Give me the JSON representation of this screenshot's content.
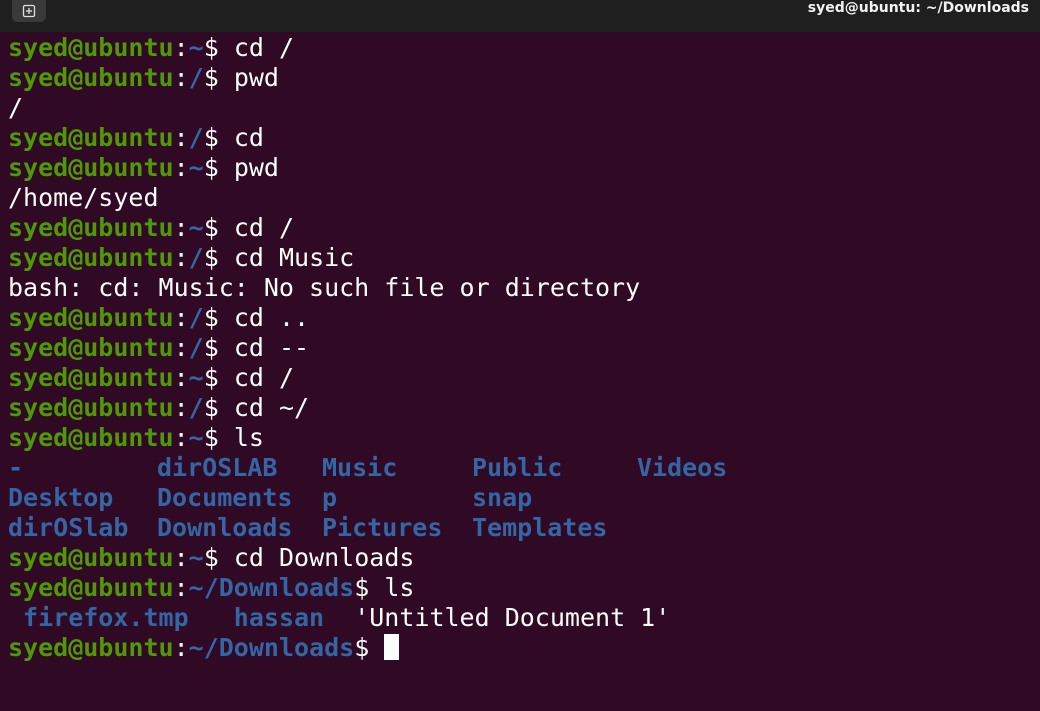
{
  "window": {
    "title": "syed@ubuntu: ~/Downloads"
  },
  "colors": {
    "background": "#300a24",
    "titlebar": "#1f1f1f",
    "user_host": "#4e9a06",
    "path": "#3465a4",
    "text": "#ffffff"
  },
  "icons": {
    "new_tab": "new-tab-icon"
  },
  "terminal": {
    "prompt_user": "syed@ubuntu",
    "lines": [
      {
        "type": "prompt",
        "path": "~",
        "cmd": "cd /"
      },
      {
        "type": "prompt",
        "path": "/",
        "cmd": "pwd"
      },
      {
        "type": "output",
        "text": "/"
      },
      {
        "type": "prompt",
        "path": "/",
        "cmd": "cd"
      },
      {
        "type": "prompt",
        "path": "~",
        "cmd": "pwd"
      },
      {
        "type": "output",
        "text": "/home/syed"
      },
      {
        "type": "prompt",
        "path": "~",
        "cmd": "cd /"
      },
      {
        "type": "prompt",
        "path": "/",
        "cmd": "cd Music"
      },
      {
        "type": "output",
        "text": "bash: cd: Music: No such file or directory"
      },
      {
        "type": "prompt",
        "path": "/",
        "cmd": "cd .."
      },
      {
        "type": "prompt",
        "path": "/",
        "cmd": "cd --"
      },
      {
        "type": "prompt",
        "path": "~",
        "cmd": "cd /"
      },
      {
        "type": "prompt",
        "path": "/",
        "cmd": "cd ~/"
      },
      {
        "type": "prompt",
        "path": "~",
        "cmd": "ls"
      },
      {
        "type": "ls",
        "cols": [
          "-",
          "dirOSLAB",
          "Music",
          "Public",
          "Videos"
        ]
      },
      {
        "type": "ls",
        "cols": [
          "Desktop",
          "Documents",
          "p",
          "snap",
          ""
        ]
      },
      {
        "type": "ls",
        "cols": [
          "dirOSlab",
          "Downloads",
          "Pictures",
          "Templates",
          ""
        ]
      },
      {
        "type": "prompt",
        "path": "~",
        "cmd": "cd Downloads"
      },
      {
        "type": "prompt",
        "path": "~/Downloads",
        "cmd": "ls"
      },
      {
        "type": "ls2",
        "items": [
          {
            "text": " firefox.tmp",
            "kind": "dir"
          },
          {
            "text": "   hassan",
            "kind": "dir"
          },
          {
            "text": "  'Untitled Document 1'",
            "kind": "file"
          }
        ]
      },
      {
        "type": "prompt_active",
        "path": "~/Downloads",
        "cmd": ""
      }
    ]
  }
}
